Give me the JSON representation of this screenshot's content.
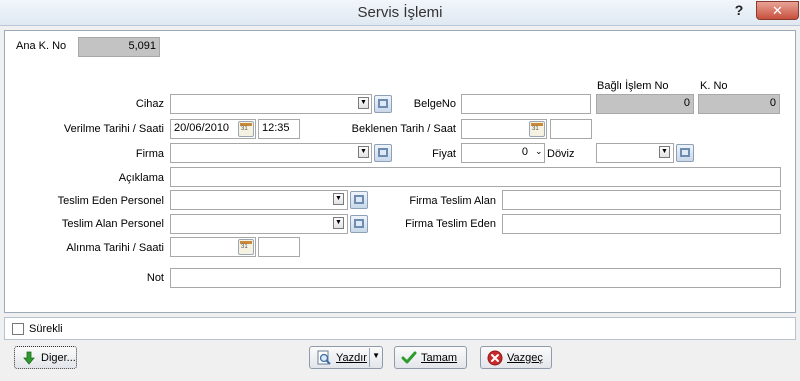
{
  "window": {
    "title": "Servis İşlemi",
    "help_label": "?",
    "close_label": "✕"
  },
  "form": {
    "ana_k_no": {
      "label": "Ana K. No",
      "value": "5,091"
    },
    "bagli_islem_no": {
      "label": "Bağlı İşlem No",
      "value": "0"
    },
    "k_no": {
      "label": "K. No",
      "value": "0"
    },
    "cihaz": {
      "label": "Cihaz",
      "value": ""
    },
    "belge_no": {
      "label": "BelgeNo",
      "value": ""
    },
    "verilme": {
      "label": "Verilme Tarihi / Saati",
      "date": "20/06/2010",
      "time": "12:35"
    },
    "beklenen": {
      "label": "Beklenen Tarih / Saat",
      "date": "",
      "time": ""
    },
    "firma": {
      "label": "Firma",
      "value": ""
    },
    "fiyat": {
      "label": "Fiyat",
      "value": "0"
    },
    "doviz": {
      "label": "Döviz",
      "value": ""
    },
    "aciklama": {
      "label": "Açıklama",
      "value": ""
    },
    "teslim_eden_personel": {
      "label": "Teslim Eden Personel",
      "value": ""
    },
    "firma_teslim_alan": {
      "label": "Firma Teslim Alan",
      "value": ""
    },
    "teslim_alan_personel": {
      "label": "Teslim Alan Personel",
      "value": ""
    },
    "firma_teslim_eden": {
      "label": "Firma Teslim Eden",
      "value": ""
    },
    "alinma": {
      "label": "Alınma Tarihi / Saati",
      "date": "",
      "time": ""
    },
    "not": {
      "label": "Not",
      "value": ""
    }
  },
  "surekli": {
    "label": "Sürekli",
    "checked": false
  },
  "buttons": {
    "diger": "Diger...",
    "yazdir": "Yazdır",
    "tamam": "Tamam",
    "vazgec": "Vazgeç"
  },
  "colors": {
    "readonly_field": "#c3c3c3",
    "ok_green": "#2e9b2e",
    "cancel_red": "#cc2a2a"
  }
}
